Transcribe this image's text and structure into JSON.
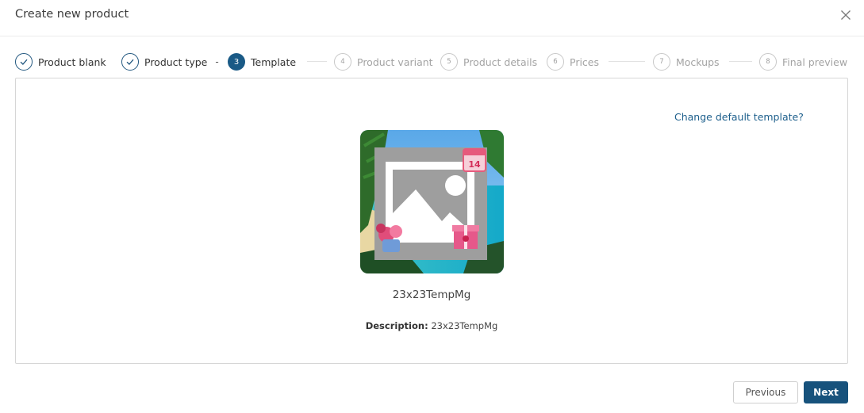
{
  "modal": {
    "title": "Create new product"
  },
  "steps": [
    {
      "number": "1",
      "label": "Product blank",
      "state": "done"
    },
    {
      "number": "2",
      "label": "Product type",
      "state": "done"
    },
    {
      "number": "3",
      "label": "Template",
      "state": "active"
    },
    {
      "number": "4",
      "label": "Product variant",
      "state": "todo"
    },
    {
      "number": "5",
      "label": "Product details",
      "state": "todo"
    },
    {
      "number": "6",
      "label": "Prices",
      "state": "todo"
    },
    {
      "number": "7",
      "label": "Mockups",
      "state": "todo"
    },
    {
      "number": "8",
      "label": "Final preview",
      "state": "todo"
    }
  ],
  "stepper": {
    "separator": "-"
  },
  "template": {
    "change_link": "Change default template?",
    "name": "23x23TempMg",
    "description_label": "Description:",
    "description_value": "23x23TempMg",
    "calendar_day": "14"
  },
  "footer": {
    "previous_label": "Previous",
    "next_label": "Next"
  },
  "colors": {
    "primary": "#17527c",
    "link": "#1d5f8c",
    "inactive": "#a3a3a3"
  },
  "icons": {
    "close": "close-icon",
    "check": "check-icon",
    "placeholder": "image-placeholder-icon"
  }
}
